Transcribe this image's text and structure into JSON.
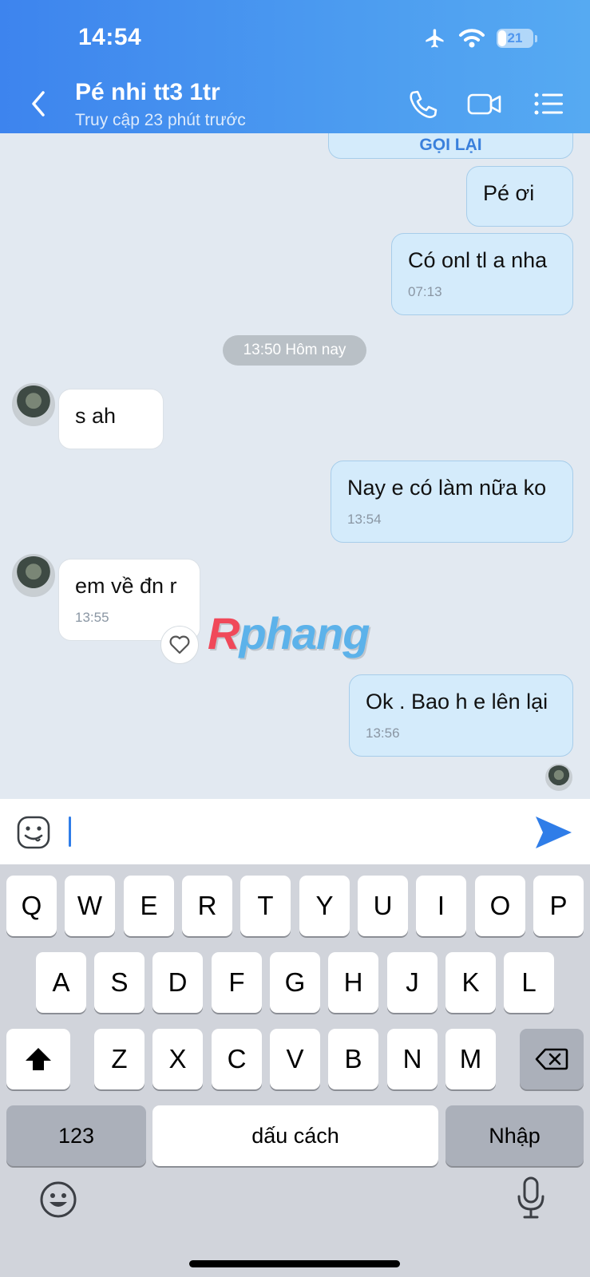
{
  "status_bar": {
    "time": "14:54",
    "battery": "21"
  },
  "header": {
    "name": "Pé nhi tt3 1tr",
    "subtitle": "Truy cập 23 phút trước"
  },
  "messages": {
    "call_back_label": "GỌI LẠI",
    "m1": {
      "text": "Pé ơi"
    },
    "m2": {
      "text": "Có onl tl a nha",
      "time": "07:13"
    },
    "date_divider": "13:50 Hôm nay",
    "m3": {
      "text": "s ah"
    },
    "m4": {
      "text": "Nay e có làm nữa ko",
      "time": "13:54"
    },
    "m5": {
      "text": "em về đn r",
      "time": "13:55"
    },
    "m6": {
      "text": "Ok . Bao h e lên lại",
      "time": "13:56"
    }
  },
  "watermark": {
    "first": "R",
    "rest": "phang"
  },
  "input": {
    "value": ""
  },
  "keyboard": {
    "row1": [
      "Q",
      "W",
      "E",
      "R",
      "T",
      "Y",
      "U",
      "I",
      "O",
      "P"
    ],
    "row2": [
      "A",
      "S",
      "D",
      "F",
      "G",
      "H",
      "J",
      "K",
      "L"
    ],
    "row3": [
      "Z",
      "X",
      "C",
      "V",
      "B",
      "N",
      "M"
    ],
    "numbers_key": "123",
    "space_key": "dấu cách",
    "return_key": "Nhập"
  },
  "colors": {
    "header_start": "#3d84ee",
    "header_end": "#56aaf2",
    "accent": "#2f7de8",
    "sent_bubble": "#d4ebfb"
  },
  "icons": [
    "airplane-icon",
    "wifi-icon",
    "back-icon",
    "phone-icon",
    "video-icon",
    "menu-icon",
    "sticker-icon",
    "send-icon",
    "heart-icon",
    "shift-icon",
    "backspace-icon",
    "emoji-icon",
    "mic-icon"
  ]
}
